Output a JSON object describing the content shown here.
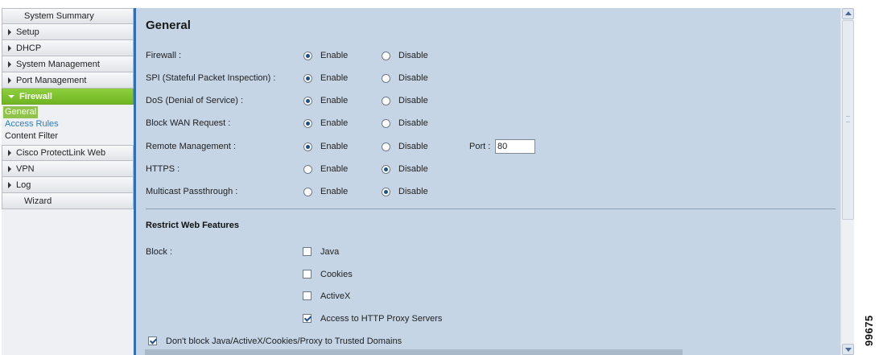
{
  "sidebar": {
    "items": [
      {
        "label": "System Summary"
      },
      {
        "label": "Setup"
      },
      {
        "label": "DHCP"
      },
      {
        "label": "System Management"
      },
      {
        "label": "Port Management"
      },
      {
        "label": "Firewall"
      },
      {
        "label": "Cisco ProtectLink Web"
      },
      {
        "label": "VPN"
      },
      {
        "label": "Log"
      },
      {
        "label": "Wizard"
      }
    ],
    "firewall_sub": [
      {
        "label": "General"
      },
      {
        "label": "Access Rules"
      },
      {
        "label": "Content Filter"
      }
    ]
  },
  "main": {
    "title": "General",
    "enable_label": "Enable",
    "disable_label": "Disable",
    "settings": [
      {
        "label": "Firewall :",
        "selected": "Enable"
      },
      {
        "label": "SPI (Stateful Packet Inspection) :",
        "selected": "Enable"
      },
      {
        "label": "DoS (Denial of Service) :",
        "selected": "Enable"
      },
      {
        "label": "Block WAN Request :",
        "selected": "Enable"
      },
      {
        "label": "Remote Management :",
        "selected": "Enable"
      },
      {
        "label": "HTTPS :",
        "selected": "Disable"
      },
      {
        "label": "Multicast Passthrough :",
        "selected": "Disable"
      }
    ],
    "port_label": "Port :",
    "port_value": "80",
    "restrict_title": "Restrict Web Features",
    "block_label": "Block :",
    "block_options": [
      {
        "label": "Java",
        "checked": false
      },
      {
        "label": "Cookies",
        "checked": false
      },
      {
        "label": "ActiveX",
        "checked": false
      },
      {
        "label": "Access to HTTP Proxy Servers",
        "checked": true
      }
    ],
    "trusted_label": "Don't block Java/ActiveX/Cookies/Proxy to Trusted Domains",
    "trusted_checked": true
  },
  "figure_id": "99675",
  "colors": {
    "accent_green": "#7cbf2e",
    "content_bg": "#c5d5e5",
    "divider_blue": "#2e6fb5",
    "link_blue": "#2a7ec0"
  }
}
